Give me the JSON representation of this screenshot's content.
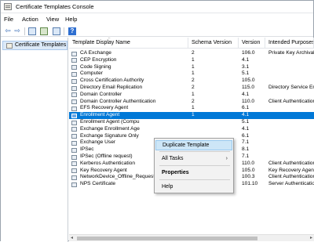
{
  "window": {
    "title": "Certificate Templates Console"
  },
  "menu": [
    "File",
    "Action",
    "View",
    "Help"
  ],
  "toolbar_icons": [
    "back-arrow-icon",
    "forward-arrow-icon",
    "console-tree-icon",
    "properties-icon",
    "export-list-icon",
    "help-icon"
  ],
  "toolbar": {
    "help_glyph": "?",
    "back_glyph": "⇦",
    "forward_glyph": "⇨"
  },
  "tree": {
    "selected": "Certificate Templates"
  },
  "columns": {
    "name": "Template Display Name",
    "schema": "Schema Version",
    "version": "Version",
    "purposes": "Intended Purposes"
  },
  "rows": [
    {
      "name": "CA Exchange",
      "schema": "2",
      "version": "106.0",
      "purposes": "Private Key Archival"
    },
    {
      "name": "CEP Encryption",
      "schema": "1",
      "version": "4.1",
      "purposes": ""
    },
    {
      "name": "Code Signing",
      "schema": "1",
      "version": "3.1",
      "purposes": ""
    },
    {
      "name": "Computer",
      "schema": "1",
      "version": "5.1",
      "purposes": ""
    },
    {
      "name": "Cross Certification Authority",
      "schema": "2",
      "version": "105.0",
      "purposes": ""
    },
    {
      "name": "Directory Email Replication",
      "schema": "2",
      "version": "115.0",
      "purposes": "Directory Service Em"
    },
    {
      "name": "Domain Controller",
      "schema": "1",
      "version": "4.1",
      "purposes": ""
    },
    {
      "name": "Domain Controller Authentication",
      "schema": "2",
      "version": "110.0",
      "purposes": "Client Authentication"
    },
    {
      "name": "EFS Recovery Agent",
      "schema": "1",
      "version": "6.1",
      "purposes": ""
    },
    {
      "name": "Enrollment Agent",
      "schema": "1",
      "version": "4.1",
      "purposes": ""
    },
    {
      "name": "Enrollment Agent (Compu",
      "schema": "",
      "version": "5.1",
      "purposes": ""
    },
    {
      "name": "Exchange Enrollment Age",
      "schema": "",
      "version": "4.1",
      "purposes": ""
    },
    {
      "name": "Exchange Signature Only",
      "schema": "",
      "version": "6.1",
      "purposes": ""
    },
    {
      "name": "Exchange User",
      "schema": "",
      "version": "7.1",
      "purposes": ""
    },
    {
      "name": "IPSec",
      "schema": "",
      "version": "8.1",
      "purposes": ""
    },
    {
      "name": "IPSec (Offline request)",
      "schema": "",
      "version": "7.1",
      "purposes": ""
    },
    {
      "name": "Kerberos Authentication",
      "schema": "2",
      "version": "110.0",
      "purposes": "Client Authentication"
    },
    {
      "name": "Key Recovery Agent",
      "schema": "2",
      "version": "105.0",
      "purposes": "Key Recovery Agent"
    },
    {
      "name": "NetworkDevice_Offline_Request",
      "schema": "2",
      "version": "100.3",
      "purposes": "Client Authentication"
    },
    {
      "name": "NPS Certificate",
      "schema": "4",
      "version": "101.10",
      "purposes": "Server Authentication"
    }
  ],
  "selected_row_index": 9,
  "context_menu": {
    "items": [
      {
        "label": "Duplicate Template",
        "highlighted": true
      },
      {
        "label": "All Tasks",
        "submenu": true
      },
      {
        "label": "Properties",
        "bold": true
      },
      {
        "label": "Help"
      }
    ],
    "submenu_glyph": "›"
  },
  "scrollbar": {
    "left_glyph": "◂",
    "right_glyph": "▸"
  }
}
